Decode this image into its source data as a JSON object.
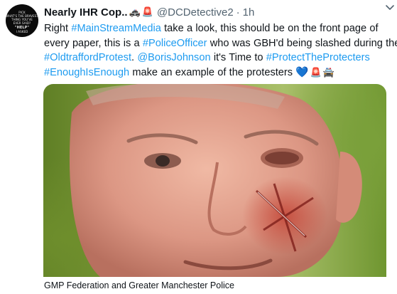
{
  "tweet": {
    "author": {
      "display_name": "Nearly IHR Cop..",
      "name_emojis": [
        "🚓",
        "🚨"
      ],
      "handle": "@DCDetective2",
      "separator": "·",
      "time": "1h",
      "avatar_lines": [
        "PICK",
        "WHAT'S THE BRAVEST",
        "THING YOU'VE",
        "EVER SAID?",
        "\"HELP\"",
        "I ASKED"
      ]
    },
    "text": {
      "l1_a": "Right ",
      "l1_tag": "#MainStreamMedia",
      "l1_b": " take a look, this should be on the front page of",
      "l2_a": "every paper, this is a ",
      "l2_tag": "#PoliceOfficer",
      "l2_b": " who was GBH'd being slashed during the",
      "l3_tag": "#OldtraffordProtest",
      "l3_a": ". ",
      "l3_mention": "@BorisJohnson",
      "l3_b": " it's Time to ",
      "l3_tag2": "#ProtectTheProtecters",
      "l4_tag": "#EnoughIsEnough",
      "l4_a": " make an example of the protesters ",
      "l4_emojis": [
        "💙",
        "🚨",
        "🚔"
      ]
    },
    "media": {
      "caption": "GMP Federation and Greater Manchester Police"
    },
    "menu_icon": "chevron-down-icon"
  }
}
